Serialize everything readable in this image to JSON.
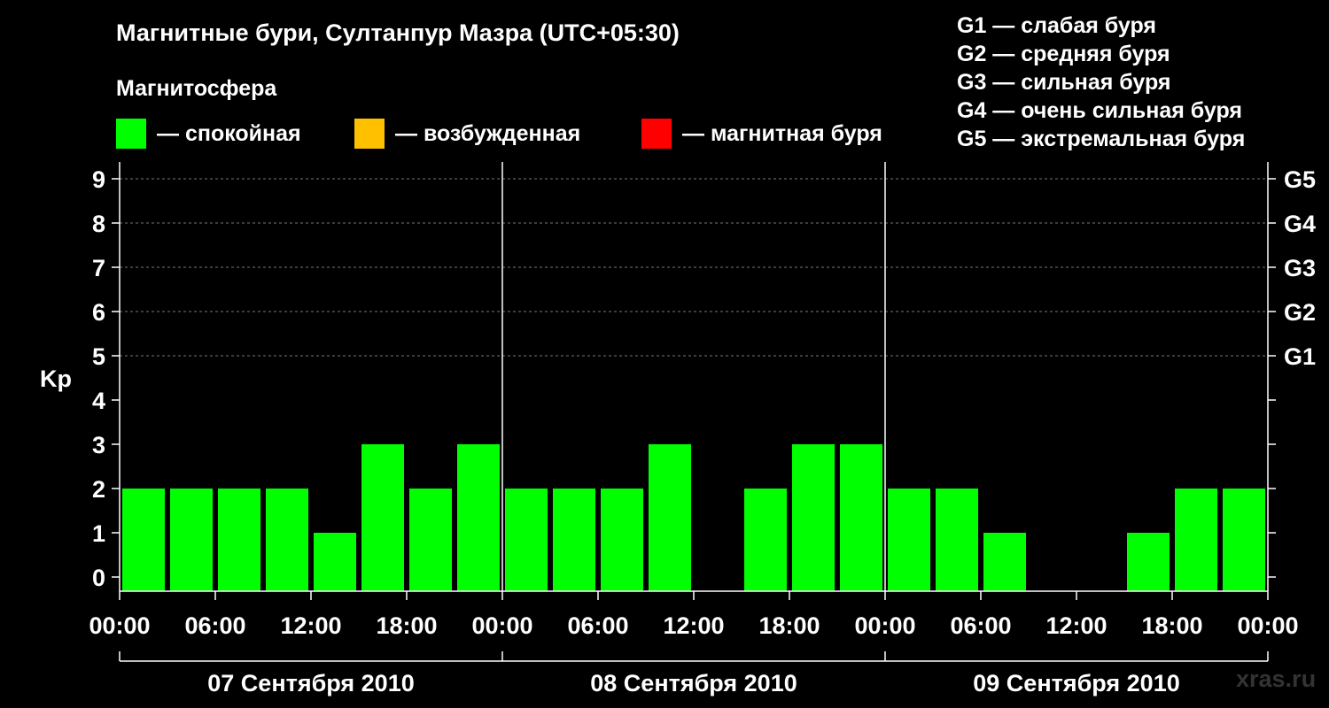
{
  "title": "Магнитные бури, Султанпур Мазра (UTC+05:30)",
  "magnetosphere_heading": "Магнитосфера",
  "legend": [
    {
      "label": "— спокойная",
      "color": "#00ff00"
    },
    {
      "label": "— возбужденная",
      "color": "#ffc000"
    },
    {
      "label": "— магнитная буря",
      "color": "#ff0000"
    }
  ],
  "g_scale": [
    "G1 — слабая буря",
    "G2 — средняя буря",
    "G3 — сильная буря",
    "G4 — очень сильная буря",
    "G5 — экстремальная буря"
  ],
  "watermark": "xras.ru",
  "chart_data": {
    "type": "bar",
    "ylabel": "Kp",
    "ylim": [
      0,
      9
    ],
    "y_ticks": [
      "0",
      "1",
      "2",
      "3",
      "4",
      "5",
      "6",
      "7",
      "8",
      "9"
    ],
    "right_axis_labels": [
      {
        "kp": 5,
        "label": "G1"
      },
      {
        "kp": 6,
        "label": "G2"
      },
      {
        "kp": 7,
        "label": "G3"
      },
      {
        "kp": 8,
        "label": "G4"
      },
      {
        "kp": 9,
        "label": "G5"
      }
    ],
    "x_tick_labels": [
      "00:00",
      "06:00",
      "12:00",
      "18:00",
      "00:00",
      "06:00",
      "12:00",
      "18:00",
      "00:00",
      "06:00",
      "12:00",
      "18:00",
      "00:00"
    ],
    "days": [
      "07 Сентября 2010",
      "08 Сентября 2010",
      "09 Сентября 2010"
    ],
    "interval_hours": 3,
    "grid": "dashed horizontal at Kp 5-9",
    "series": [
      {
        "values": [
          2,
          2,
          2,
          2,
          1,
          3,
          2,
          3,
          2,
          2,
          2,
          3,
          0,
          2,
          3,
          3,
          2,
          2,
          1,
          0,
          0,
          1,
          2,
          2
        ]
      }
    ]
  }
}
